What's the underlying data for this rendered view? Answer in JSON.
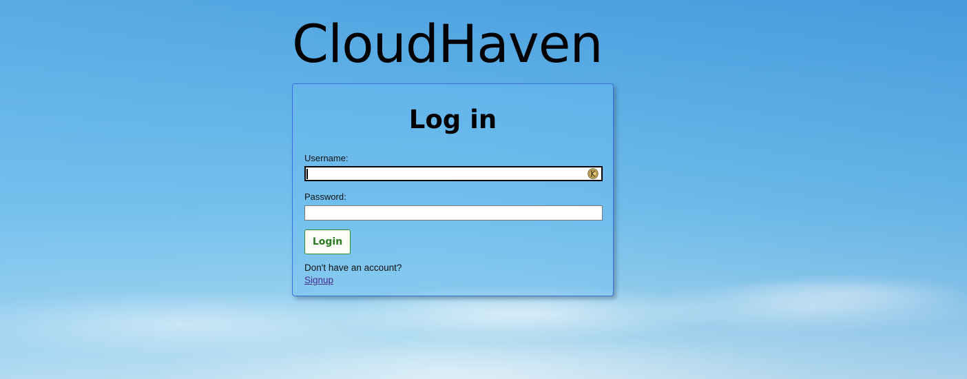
{
  "app": {
    "title": "CloudHaven"
  },
  "login_form": {
    "heading": "Log in",
    "username_label": "Username:",
    "username_value": "",
    "password_label": "Password:",
    "password_value": "",
    "submit_label": "Login",
    "no_account_text": "Don't have an account?",
    "signup_link_label": "Signup"
  },
  "icons": {
    "password_manager": "keeper-autofill-icon"
  },
  "colors": {
    "card_border": "#3b6fe0",
    "login_button_text": "#2b7a1f",
    "login_button_border": "#2e8b2e",
    "signup_link": "#4b2a8e",
    "sky_top": "#4fa3e0",
    "sky_bottom": "#c6e4f2"
  }
}
